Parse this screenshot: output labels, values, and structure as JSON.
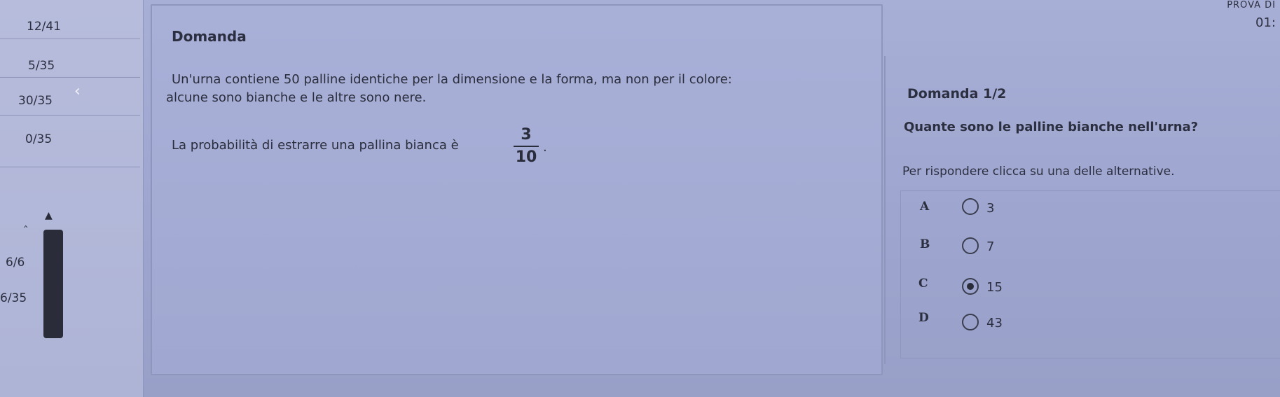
{
  "sidebar": {
    "scores": [
      "12/41",
      "5/35",
      "30/35",
      "0/35",
      "6/6",
      "6/35"
    ]
  },
  "header": {
    "exam_label": "PROVA DI",
    "timer": "01:"
  },
  "question": {
    "title": "Domanda",
    "line1": "Un'urna contiene 50 palline identiche per la dimensione e la forma, ma non per il colore:",
    "line2": "alcune sono bianche e le altre sono nere.",
    "prob_text": "La probabilità di estrarre una pallina bianca è",
    "fraction_num": "3",
    "fraction_den": "10",
    "period": "."
  },
  "answer": {
    "title": "Domanda 1/2",
    "question": "Quante sono le palline bianche nell'urna?",
    "instruction": "Per rispondere clicca su una delle alternative.",
    "options": [
      {
        "letter": "A",
        "value": "3",
        "selected": false
      },
      {
        "letter": "B",
        "value": "7",
        "selected": false
      },
      {
        "letter": "C",
        "value": "15",
        "selected": true
      },
      {
        "letter": "D",
        "value": "43",
        "selected": false
      }
    ]
  }
}
